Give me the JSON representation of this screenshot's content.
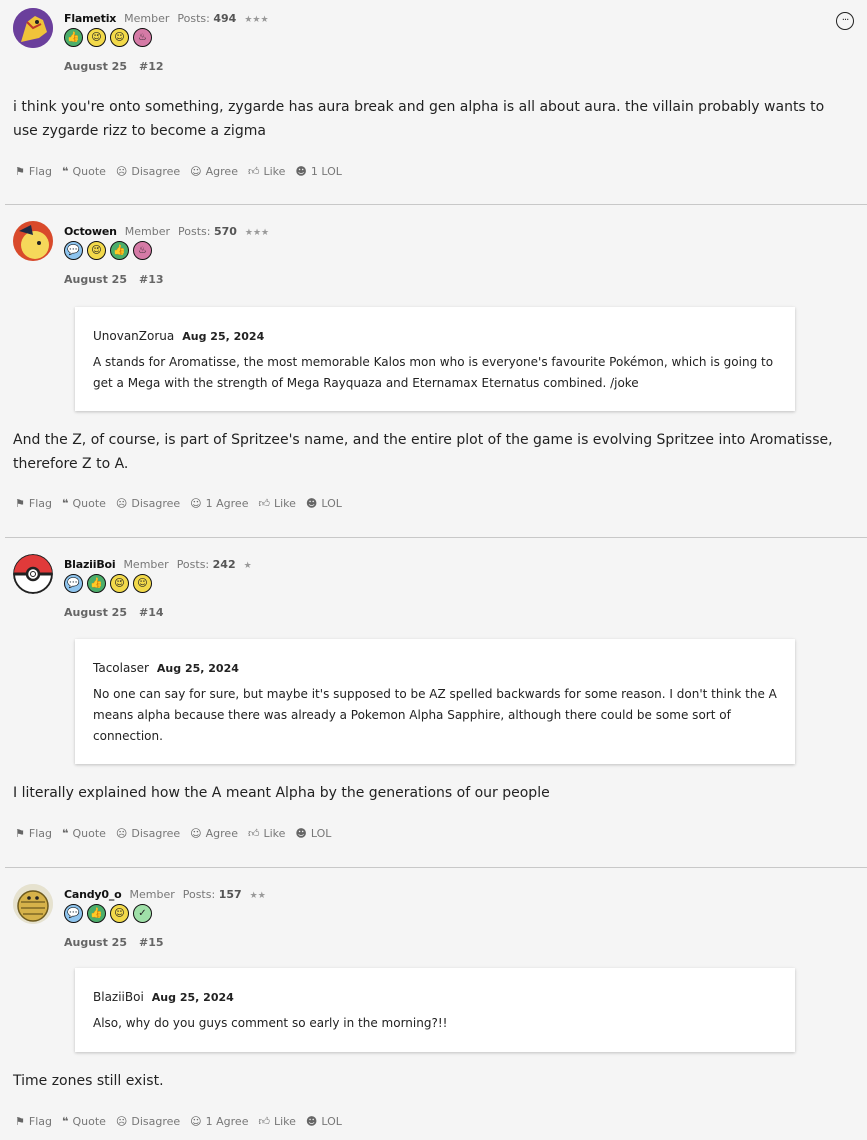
{
  "posts": [
    {
      "username": "Flametix",
      "role": "Member",
      "posts_label": "Posts:",
      "posts_count": "494",
      "stars": "★★★",
      "date": "August 25",
      "number": "#12",
      "body": "i think you're onto something, zygarde has aura break and gen alpha is all about aura. the villain probably wants to use zygarde rizz to become a zigma",
      "actions": {
        "flag": "Flag",
        "quote": "Quote",
        "disagree": "Disagree",
        "agree": "Agree",
        "like": "Like",
        "lol": "1 LOL"
      }
    },
    {
      "username": "Octowen",
      "role": "Member",
      "posts_label": "Posts:",
      "posts_count": "570",
      "stars": "★★★",
      "date": "August 25",
      "number": "#13",
      "quote": {
        "author": "UnovanZorua",
        "date": "Aug 25, 2024",
        "text": "A stands for Aromatisse, the most memorable Kalos mon who is everyone's favourite Pokémon, which is going to get a Mega with the strength of Mega Rayquaza and Eternamax Eternatus combined. /joke"
      },
      "body": "And the Z, of course, is part of Spritzee's name, and the entire plot of the game is evolving Spritzee into Aromatisse, therefore Z to A.",
      "actions": {
        "flag": "Flag",
        "quote": "Quote",
        "disagree": "Disagree",
        "agree": "1 Agree",
        "like": "Like",
        "lol": "LOL"
      }
    },
    {
      "username": "BlaziiBoi",
      "role": "Member",
      "posts_label": "Posts:",
      "posts_count": "242",
      "stars": "★",
      "date": "August 25",
      "number": "#14",
      "quote": {
        "author": "Tacolaser",
        "date": "Aug 25, 2024",
        "text": "No one can say for sure, but maybe it's supposed to be AZ spelled backwards for some reason. I don't think the A means alpha because there was already a Pokemon Alpha Sapphire, although there could be some sort of connection."
      },
      "body": "I literally explained how the A meant Alpha by the generations of our people",
      "actions": {
        "flag": "Flag",
        "quote": "Quote",
        "disagree": "Disagree",
        "agree": "Agree",
        "like": "Like",
        "lol": "LOL"
      }
    },
    {
      "username": "Candy0_o",
      "role": "Member",
      "posts_label": "Posts:",
      "posts_count": "157",
      "stars": "★★",
      "date": "August 25",
      "number": "#15",
      "quote": {
        "author": "BlaziiBoi",
        "date": "Aug 25, 2024",
        "text": "Also, why do you guys comment so early in the morning?!!"
      },
      "body": "Time zones still exist.",
      "actions": {
        "flag": "Flag",
        "quote": "Quote",
        "disagree": "Disagree",
        "agree": "1 Agree",
        "like": "Like",
        "lol": "LOL"
      }
    }
  ],
  "icons": {
    "menu": "more-options-icon",
    "flag": "flag-icon",
    "quote": "quote-icon",
    "disagree": "disagree-face-icon",
    "agree": "agree-face-icon",
    "like": "thumbs-up-icon",
    "lol": "laugh-face-icon"
  }
}
